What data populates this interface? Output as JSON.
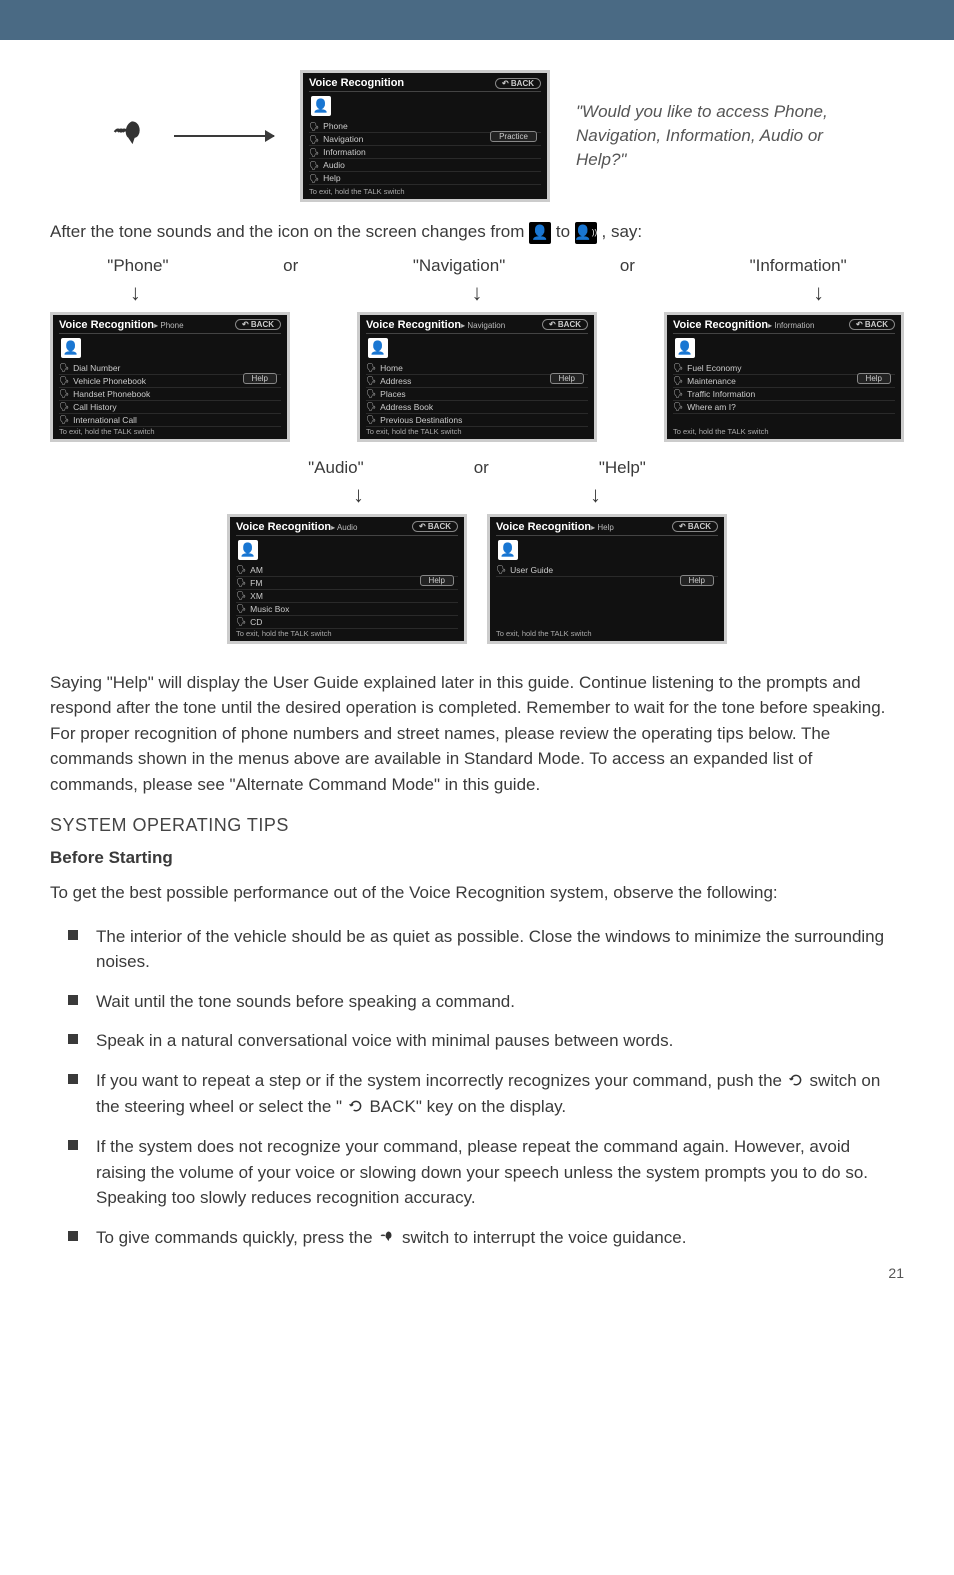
{
  "top_prompt": "\"Would you like to access Phone, Navigation, Information, Audio or Help?\"",
  "after_tone_prefix": "After the tone sounds and the icon on the screen changes from ",
  "after_tone_mid": " to ",
  "after_tone_suffix": ", say:",
  "screens": {
    "main": {
      "title": "Voice Recognition",
      "back": "BACK",
      "side_btn": "Practice",
      "items": [
        "Phone",
        "Navigation",
        "Information",
        "Audio",
        "Help"
      ],
      "footer": "To exit, hold the TALK switch"
    },
    "phone": {
      "title": "Voice Recognition",
      "sub": "▸ Phone",
      "back": "BACK",
      "side_btn": "Help",
      "items": [
        "Dial Number",
        "Vehicle Phonebook",
        "Handset Phonebook",
        "Call History",
        "International Call"
      ],
      "footer": "To exit, hold the TALK switch"
    },
    "navigation": {
      "title": "Voice Recognition",
      "sub": "▸ Navigation",
      "back": "BACK",
      "side_btn": "Help",
      "items": [
        "Home",
        "Address",
        "Places",
        "Address Book",
        "Previous Destinations"
      ],
      "footer": "To exit, hold the TALK switch"
    },
    "information": {
      "title": "Voice Recognition",
      "sub": "▸ Information",
      "back": "BACK",
      "side_btn": "Help",
      "items": [
        "Fuel Economy",
        "Maintenance",
        "Traffic Information",
        "Where am I?"
      ],
      "footer": "To exit, hold the TALK switch"
    },
    "audio": {
      "title": "Voice Recognition",
      "sub": "▸ Audio",
      "back": "BACK",
      "side_btn": "Help",
      "items": [
        "AM",
        "FM",
        "XM",
        "Music Box",
        "CD"
      ],
      "footer": "To exit, hold the TALK switch"
    },
    "help": {
      "title": "Voice Recognition",
      "sub": "▸ Help",
      "back": "BACK",
      "side_btn": "Help",
      "items": [
        "User Guide"
      ],
      "footer": "To exit, hold the TALK switch"
    }
  },
  "labels": {
    "phone": "\"Phone\"",
    "navigation": "\"Navigation\"",
    "information": "\"Information\"",
    "audio": "\"Audio\"",
    "help": "\"Help\"",
    "or": "or"
  },
  "paragraph": "Saying \"Help\" will display the User Guide explained later in this guide. Continue listening to the prompts and respond after the tone until the desired operation is completed. Remember to wait for the tone before speaking. For proper recognition of phone numbers and street names, please review the operating tips below. The commands shown in the menus above are available in Standard Mode. To access an expanded list of commands, please see \"Alternate Command Mode\" in this guide.",
  "h2": "SYSTEM OPERATING TIPS",
  "h3": "Before Starting",
  "intro_tip": "To get the best possible performance out of the Voice Recognition system, observe the following:",
  "tips": {
    "t1": "The interior of the vehicle should be as quiet as possible. Close the windows to minimize the surrounding noises.",
    "t2": "Wait until the tone sounds before speaking a command.",
    "t3": "Speak in a natural conversational voice with minimal pauses between words.",
    "t4a": "If you want to repeat a step or if the system incorrectly recognizes your command, push the ",
    "t4b": " switch on the steering wheel or select the \" ",
    "t4c": " BACK\" key on the display.",
    "t5": "If the system does not recognize your command, please repeat the command again. However, avoid raising the volume of your voice or slowing down your speech unless the system prompts you to do so. Speaking too slowly reduces recognition accuracy.",
    "t6a": "To give commands quickly, press the ",
    "t6b": " switch to interrupt the voice guidance."
  },
  "page_number": "21"
}
